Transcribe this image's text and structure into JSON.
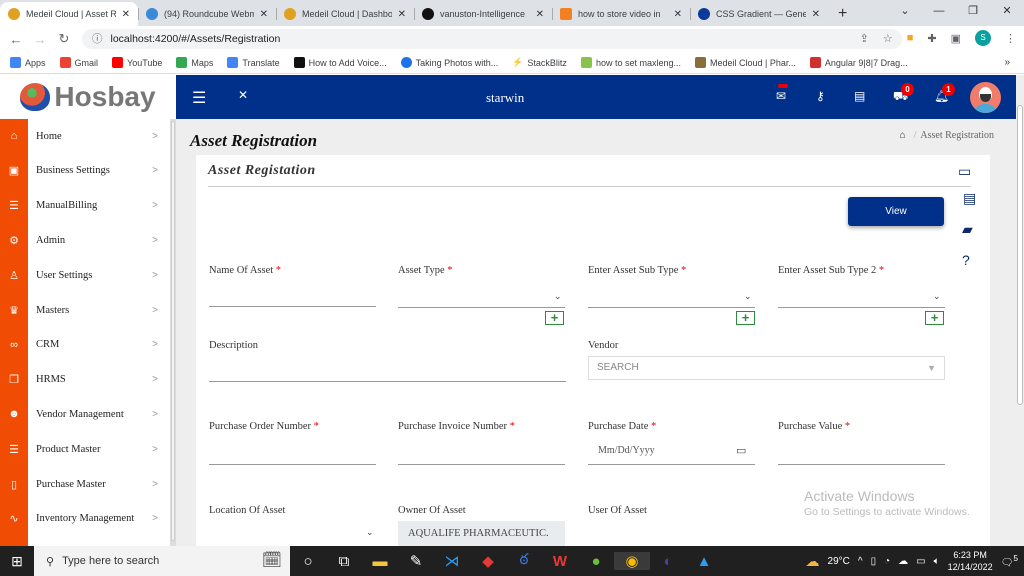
{
  "browser": {
    "tabs": [
      {
        "title": "Medeil Cloud | Asset R",
        "active": true,
        "favicon_color": "#e0a020"
      },
      {
        "title": "(94) Roundcube Webm",
        "active": false,
        "favicon_color": "#3a8ad6"
      },
      {
        "title": "Medeil Cloud | Dashbo",
        "active": false,
        "favicon_color": "#e0a020"
      },
      {
        "title": "vanuston-Intelligence",
        "active": false,
        "favicon_color": "#111111"
      },
      {
        "title": "how to store video in",
        "active": false,
        "favicon_color": "#f48024"
      },
      {
        "title": "CSS Gradient — Gene",
        "active": false,
        "favicon_color": "#0a3a9a"
      }
    ],
    "new_tab": "+",
    "window_controls": [
      "⌄",
      "—",
      "❐",
      "✕"
    ],
    "url": "localhost:4200/#/Assets/Registration",
    "profile_initial": "S",
    "bookmarks": [
      {
        "label": "Apps",
        "color": "#4285f4"
      },
      {
        "label": "Gmail",
        "color": "#ea4335"
      },
      {
        "label": "YouTube",
        "color": "#ff0000"
      },
      {
        "label": "Maps",
        "color": "#34a853"
      },
      {
        "label": "Translate",
        "color": "#4285f4"
      },
      {
        "label": "How to Add Voice...",
        "color": "#111111"
      },
      {
        "label": "Taking Photos with...",
        "color": "#1a73e8"
      },
      {
        "label": "StackBlitz",
        "color": "#1389fd"
      },
      {
        "label": "how to set maxleng...",
        "color": "#8bc34a"
      },
      {
        "label": "Medeil Cloud | Phar...",
        "color": "#8a6d3b"
      },
      {
        "label": "Angular 9|8|7 Drag...",
        "color": "#d32f2f"
      }
    ],
    "bookmarks_more": "»"
  },
  "app": {
    "logo_text": "Hosbay",
    "header_title": "starwin",
    "badges": {
      "cart": "0",
      "notifications": "1"
    },
    "sidebar": [
      {
        "label": "Home",
        "icon": "home-icon",
        "glyph": "⌂"
      },
      {
        "label": "Business Settings",
        "icon": "save-icon",
        "glyph": "▣"
      },
      {
        "label": "ManualBilling",
        "icon": "database-icon",
        "glyph": "☰"
      },
      {
        "label": "Admin",
        "icon": "gear-icon",
        "glyph": "⚙"
      },
      {
        "label": "User Settings",
        "icon": "user-icon",
        "glyph": "♙"
      },
      {
        "label": "Masters",
        "icon": "crown-icon",
        "glyph": "♛"
      },
      {
        "label": "CRM",
        "icon": "link-icon",
        "glyph": "∞"
      },
      {
        "label": "HRMS",
        "icon": "layers-icon",
        "glyph": "❐"
      },
      {
        "label": "Vendor Management",
        "icon": "person-icon",
        "glyph": "☻"
      },
      {
        "label": "Product Master",
        "icon": "database-icon",
        "glyph": "☰"
      },
      {
        "label": "Purchase Master",
        "icon": "book-icon",
        "glyph": "▯"
      },
      {
        "label": "Inventory Management",
        "icon": "pulse-icon",
        "glyph": "∿"
      }
    ],
    "page_title": "Asset Registration",
    "breadcrumb": {
      "current": "Asset Registration",
      "separator": "/"
    },
    "card_title": "Asset Registation",
    "view_button": "View",
    "form": {
      "required_mark": "*",
      "name_of_asset": "Name Of Asset",
      "asset_type": "Asset Type",
      "asset_sub_type": "Enter Asset Sub Type",
      "asset_sub_type_2": "Enter Asset Sub Type 2",
      "description": "Description",
      "vendor": "Vendor",
      "vendor_placeholder": "SEARCH",
      "purchase_order_number": "Purchase Order Number",
      "purchase_invoice_number": "Purchase Invoice Number",
      "purchase_date": "Purchase Date",
      "purchase_date_placeholder": "Mm/Dd/Yyyy",
      "purchase_value": "Purchase Value",
      "location_of_asset": "Location Of Asset",
      "owner_of_asset": "Owner Of Asset",
      "owner_value": "AQUALIFE PHARMACEUTIC.",
      "user_of_asset": "User Of Asset"
    }
  },
  "watermark": {
    "title": "Activate Windows",
    "subtitle": "Go to Settings to activate Windows."
  },
  "taskbar": {
    "search_placeholder": "Type here to search",
    "weather": "29°C",
    "time": "6:23 PM",
    "date": "12/14/2022",
    "notification_count": "5"
  }
}
